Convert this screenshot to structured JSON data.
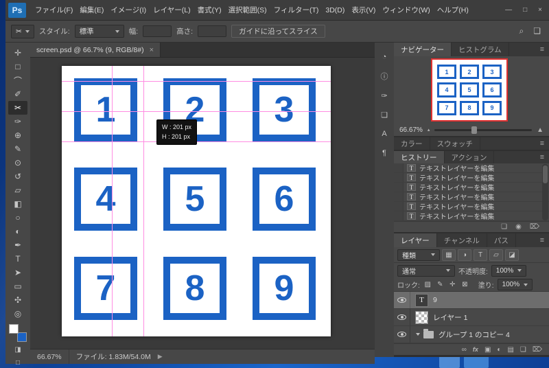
{
  "colors": {
    "accent_blue": "#1b62c4",
    "guide_pink": "#ff8ce2",
    "navigator_proxy_red": "#e03030",
    "selected_layer_gray": "#6d6d6d",
    "desktop_blue": "#1a66cc"
  },
  "window": {
    "controls": {
      "minimize": "—",
      "maximize": "□",
      "close": "×"
    }
  },
  "menubar": {
    "logo": "Ps",
    "items": [
      {
        "label": "ファイル(F)"
      },
      {
        "label": "編集(E)"
      },
      {
        "label": "イメージ(I)"
      },
      {
        "label": "レイヤー(L)"
      },
      {
        "label": "書式(Y)"
      },
      {
        "label": "選択範囲(S)"
      },
      {
        "label": "フィルター(T)"
      },
      {
        "label": "3D(D)"
      },
      {
        "label": "表示(V)"
      },
      {
        "label": "ウィンドウ(W)"
      },
      {
        "label": "ヘルプ(H)"
      }
    ]
  },
  "options_bar": {
    "tool_icon": "✂",
    "style_label": "スタイル:",
    "style_value": "標準",
    "width_label": "幅:",
    "width_value": "",
    "height_label": "高さ:",
    "height_value": "",
    "slice_button": "ガイドに沿ってスライス",
    "right_icons": [
      {
        "name": "search-icon",
        "glyph": "⌕"
      },
      {
        "name": "workspace-switcher-icon",
        "glyph": "❏"
      }
    ]
  },
  "document": {
    "tab_title": "screen.psd @ 66.7% (9, RGB/8#)",
    "tab_close": "×",
    "grid_numbers": [
      "1",
      "2",
      "3",
      "4",
      "5",
      "6",
      "7",
      "8",
      "9"
    ],
    "tooltip": {
      "line1": "W :  201 px",
      "line2": "H :  201 px"
    }
  },
  "toolbar": {
    "tools": [
      {
        "name": "move-tool",
        "glyph": "✛"
      },
      {
        "name": "marquee-tool",
        "glyph": "□"
      },
      {
        "name": "lasso-tool",
        "glyph": "⌒"
      },
      {
        "name": "quick-selection-tool",
        "glyph": "✐"
      },
      {
        "name": "slice-tool",
        "glyph": "✂",
        "active": true
      },
      {
        "name": "eyedropper-tool",
        "glyph": "✑"
      },
      {
        "name": "healing-brush-tool",
        "glyph": "⊕"
      },
      {
        "name": "brush-tool",
        "glyph": "✎"
      },
      {
        "name": "clone-stamp-tool",
        "glyph": "⊙"
      },
      {
        "name": "history-brush-tool",
        "glyph": "↺"
      },
      {
        "name": "eraser-tool",
        "glyph": "▱"
      },
      {
        "name": "gradient-tool",
        "glyph": "◧"
      },
      {
        "name": "blur-tool",
        "glyph": "○"
      },
      {
        "name": "dodge-tool",
        "glyph": "◐"
      },
      {
        "name": "pen-tool",
        "glyph": "✒"
      },
      {
        "name": "type-tool",
        "glyph": "T"
      },
      {
        "name": "path-selection-tool",
        "glyph": "➤"
      },
      {
        "name": "rectangle-tool",
        "glyph": "▭"
      },
      {
        "name": "hand-tool",
        "glyph": "✣"
      },
      {
        "name": "zoom-tool",
        "glyph": "◎"
      }
    ],
    "bottom_icons": [
      {
        "name": "quick-mask-icon",
        "glyph": "◨"
      },
      {
        "name": "screen-mode-icon",
        "glyph": "□"
      }
    ]
  },
  "dock_icons": [
    {
      "name": "histogram-panel-icon",
      "glyph": "◔"
    },
    {
      "name": "info-panel-icon",
      "glyph": "ⓘ"
    },
    {
      "name": "brush-presets-panel-icon",
      "glyph": "✑"
    },
    {
      "name": "clone-source-panel-icon",
      "glyph": "❏"
    },
    {
      "name": "character-panel-icon",
      "glyph": "A"
    },
    {
      "name": "paragraph-panel-icon",
      "glyph": "¶"
    }
  ],
  "panels": {
    "menu_glyph": "≡",
    "navigator": {
      "tabs": [
        {
          "label": "ナビゲーター",
          "active": true
        },
        {
          "label": "ヒストグラム",
          "active": false
        }
      ],
      "zoom": "66.67%",
      "slider_small": "▴",
      "slider_large": "▲"
    },
    "color": {
      "tabs": [
        {
          "label": "カラー"
        },
        {
          "label": "スウォッチ"
        }
      ]
    },
    "history": {
      "tabs": [
        {
          "label": "ヒストリー",
          "active": true
        },
        {
          "label": "アクション"
        }
      ],
      "item_icon": "T",
      "items": [
        "テキストレイヤーを編集",
        "テキストレイヤーを編集",
        "テキストレイヤーを編集",
        "テキストレイヤーを編集",
        "テキストレイヤーを編集",
        "テキストレイヤーを編集"
      ],
      "bottom_icons": [
        {
          "name": "new-document-from-state-icon",
          "glyph": "❏"
        },
        {
          "name": "new-snapshot-icon",
          "glyph": "◉"
        },
        {
          "name": "delete-state-icon",
          "glyph": "⌦"
        }
      ]
    },
    "layers": {
      "tabs": [
        {
          "label": "レイヤー",
          "active": true
        },
        {
          "label": "チャンネル"
        },
        {
          "label": "パス"
        }
      ],
      "kind_label": "種類",
      "filter_icons": [
        {
          "name": "filter-pixel-layers-icon",
          "glyph": "▦"
        },
        {
          "name": "filter-adjustment-layers-icon",
          "glyph": "◑"
        },
        {
          "name": "filter-type-layers-icon",
          "glyph": "T"
        },
        {
          "name": "filter-shape-layers-icon",
          "glyph": "▱"
        },
        {
          "name": "filter-smart-objects-icon",
          "glyph": "◪"
        }
      ],
      "blend_mode": "通常",
      "opacity_label": "不透明度:",
      "opacity_value": "100%",
      "lock_label": "ロック:",
      "lock_icons": [
        {
          "name": "lock-transparency-icon",
          "glyph": "▨"
        },
        {
          "name": "lock-pixels-icon",
          "glyph": "✎"
        },
        {
          "name": "lock-position-icon",
          "glyph": "✛"
        },
        {
          "name": "lock-all-icon",
          "glyph": "⊠"
        }
      ],
      "fill_label": "塗り:",
      "fill_value": "100%",
      "rows": [
        {
          "name": "9",
          "thumb": "T",
          "type": "text",
          "selected": true
        },
        {
          "name": "レイヤー 1",
          "type": "pixel",
          "selected": false
        },
        {
          "name": "グループ 1 のコピー 4",
          "type": "group",
          "selected": false
        }
      ],
      "bottom_icons": [
        {
          "name": "link-layers-icon",
          "glyph": "∞"
        },
        {
          "name": "layer-effects-icon",
          "glyph": "fx"
        },
        {
          "name": "add-layer-mask-icon",
          "glyph": "▣"
        },
        {
          "name": "new-adjustment-layer-icon",
          "glyph": "◐"
        },
        {
          "name": "new-group-icon",
          "glyph": "▤"
        },
        {
          "name": "new-layer-icon",
          "glyph": "❏"
        },
        {
          "name": "delete-layer-icon",
          "glyph": "⌦"
        }
      ]
    }
  },
  "status_bar": {
    "zoom": "66.67%",
    "file_label": "ファイル: 1.83M/54.0M",
    "arrow": "▶"
  }
}
